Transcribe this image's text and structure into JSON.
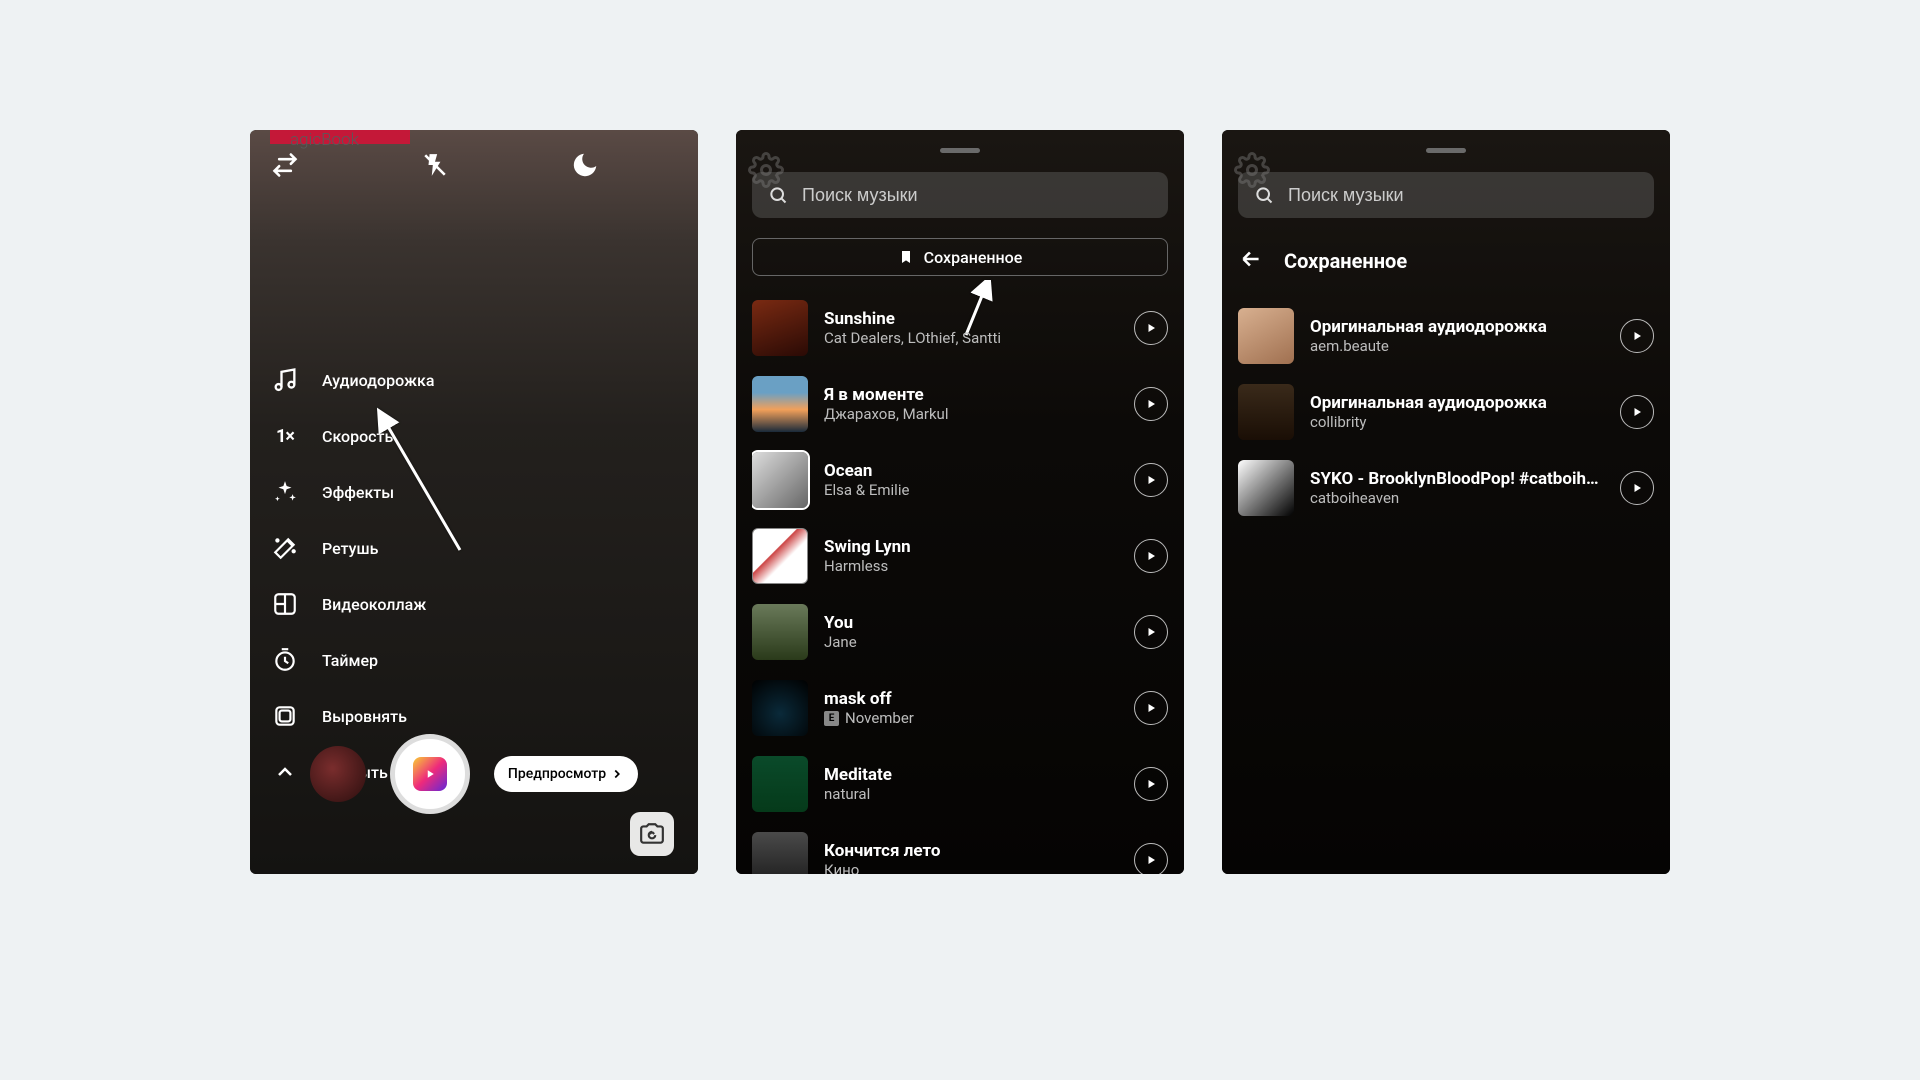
{
  "screen1": {
    "sideMenu": [
      {
        "icon": "music",
        "label": "Аудиодорожка"
      },
      {
        "icon": "speed",
        "label": "Скорость",
        "speedValue": "1×"
      },
      {
        "icon": "sparkle",
        "label": "Эффекты"
      },
      {
        "icon": "wand",
        "label": "Ретушь"
      },
      {
        "icon": "collage",
        "label": "Видеоколлаж"
      },
      {
        "icon": "timer",
        "label": "Таймер"
      },
      {
        "icon": "align",
        "label": "Выровнять"
      },
      {
        "icon": "close",
        "label": "Закрыть"
      }
    ],
    "previewButton": "Предпросмотр",
    "topBadgeText": "agicBook"
  },
  "screen2": {
    "searchPlaceholder": "Поиск музыки",
    "savedButton": "Сохраненное",
    "tracks": [
      {
        "title": "Sunshine",
        "artist": "Cat Dealers, LOthief, Santti",
        "cover": "cv1",
        "explicit": false
      },
      {
        "title": "Я в моменте",
        "artist": "Джарахов, Markul",
        "cover": "cv2",
        "explicit": false
      },
      {
        "title": "Ocean",
        "artist": "Elsa & Emilie",
        "cover": "cv3",
        "explicit": false,
        "selected": true
      },
      {
        "title": "Swing Lynn",
        "artist": "Harmless",
        "cover": "cv4",
        "explicit": false
      },
      {
        "title": "You",
        "artist": "Jane",
        "cover": "cv5",
        "explicit": false
      },
      {
        "title": "mask off",
        "artist": "November",
        "cover": "cv6",
        "explicit": true
      },
      {
        "title": "Meditate",
        "artist": "natural",
        "cover": "cv7",
        "explicit": false
      },
      {
        "title": "Кончится лето",
        "artist": "Кино",
        "cover": "cv8",
        "explicit": false
      }
    ]
  },
  "screen3": {
    "searchPlaceholder": "Поиск музыки",
    "headerTitle": "Сохраненное",
    "tracks": [
      {
        "title": "Оригинальная аудиодорожка",
        "artist": "aem.beaute",
        "cover": "cv9"
      },
      {
        "title": "Оригинальная аудиодорожка",
        "artist": "collibrity",
        "cover": "cv10"
      },
      {
        "title": "SYKO - BrooklynBloodPop! #catboiheaven",
        "artist": "catboiheaven",
        "cover": "cv11"
      }
    ]
  }
}
